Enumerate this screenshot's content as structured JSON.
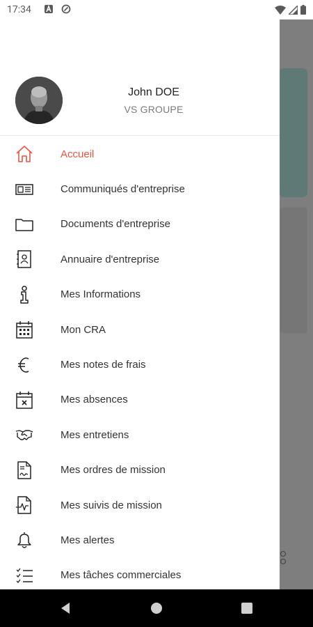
{
  "status_bar": {
    "time": "17:34",
    "left_icons": [
      "notification-a-icon",
      "sync-icon"
    ],
    "right_icons": [
      "wifi-icon",
      "signal-icon",
      "battery-icon"
    ]
  },
  "profile": {
    "name": "John DOE",
    "company": "VS GROUPE"
  },
  "menu": {
    "active_color": "#e8553e",
    "items": [
      {
        "label": "Accueil",
        "icon": "home-icon",
        "active": true
      },
      {
        "label": "Communiqués d'entreprise",
        "icon": "newspaper-icon"
      },
      {
        "label": "Documents d'entreprise",
        "icon": "folder-icon"
      },
      {
        "label": "Annuaire d'entreprise",
        "icon": "contacts-book-icon"
      },
      {
        "label": "Mes Informations",
        "icon": "info-icon"
      },
      {
        "label": "Mon CRA",
        "icon": "calendar-icon"
      },
      {
        "label": "Mes notes de frais",
        "icon": "euro-icon"
      },
      {
        "label": "Mes absences",
        "icon": "calendar-x-icon"
      },
      {
        "label": "Mes entretiens",
        "icon": "handshake-icon"
      },
      {
        "label": "Mes ordres de mission",
        "icon": "document-signature-icon"
      },
      {
        "label": "Mes suivis de mission",
        "icon": "document-chart-icon"
      },
      {
        "label": "Mes alertes",
        "icon": "bell-icon"
      },
      {
        "label": "Mes tâches commerciales",
        "icon": "checklist-icon"
      }
    ]
  },
  "nav_bar": {
    "buttons": [
      "back-icon",
      "home-circle-icon",
      "recents-icon"
    ]
  }
}
